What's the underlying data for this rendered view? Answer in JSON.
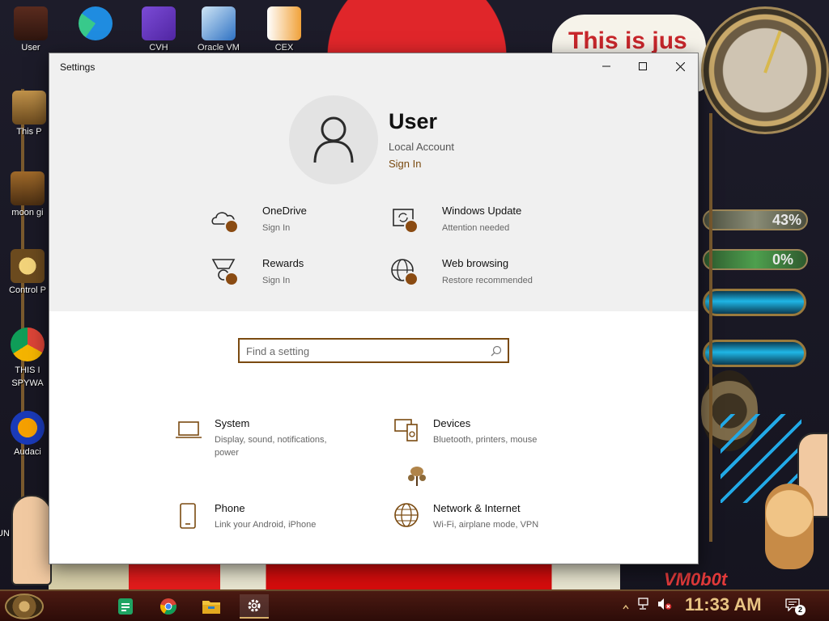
{
  "desktop": {
    "icons": [
      {
        "label": "User"
      },
      {
        "label": "This P"
      },
      {
        "label": "moon gi"
      },
      {
        "label": "Control P"
      },
      {
        "label": "THIS I SPYWA"
      },
      {
        "label": "Audaci"
      },
      {
        "label": "UN"
      }
    ],
    "top_icons": [
      {
        "label": ""
      },
      {
        "label": "CVH"
      },
      {
        "label": "Oracle VM"
      },
      {
        "label": "CEX"
      }
    ],
    "banner_text": "This is jus",
    "gauges": [
      {
        "label": "43%"
      },
      {
        "label": "0%"
      }
    ],
    "watermark": "VM0b0t"
  },
  "window": {
    "title": "Settings",
    "controls": {
      "minimize": "–",
      "maximize": "□",
      "close": "✕"
    }
  },
  "account": {
    "name": "User",
    "type": "Local Account",
    "sign_in": "Sign In"
  },
  "quick_links": [
    {
      "title": "OneDrive",
      "subtitle": "Sign In",
      "icon": "cloud-icon"
    },
    {
      "title": "Windows Update",
      "subtitle": "Attention needed",
      "icon": "update-icon"
    },
    {
      "title": "Rewards",
      "subtitle": "Sign In",
      "icon": "medal-icon"
    },
    {
      "title": "Web browsing",
      "subtitle": "Restore recommended",
      "icon": "globe-icon"
    }
  ],
  "search": {
    "placeholder": "Find a setting",
    "value": ""
  },
  "categories": [
    {
      "title": "System",
      "subtitle": "Display, sound, notifications, power",
      "icon": "laptop-icon"
    },
    {
      "title": "Devices",
      "subtitle": "Bluetooth, printers, mouse",
      "icon": "devices-icon"
    },
    {
      "title": "Phone",
      "subtitle": "Link your Android, iPhone",
      "icon": "phone-icon"
    },
    {
      "title": "Network & Internet",
      "subtitle": "Wi-Fi, airplane mode, VPN",
      "icon": "globe-icon"
    }
  ],
  "taskbar": {
    "time": "11:33 AM",
    "notification_count": "2",
    "apps": [
      "sheets-icon",
      "chrome-icon",
      "file-explorer-icon",
      "settings-gear-icon"
    ]
  },
  "colors": {
    "accent": "#7a4a10",
    "badge": "#8a4b12",
    "window_header": "#f0f0f0",
    "clock_text": "#e8c483"
  }
}
